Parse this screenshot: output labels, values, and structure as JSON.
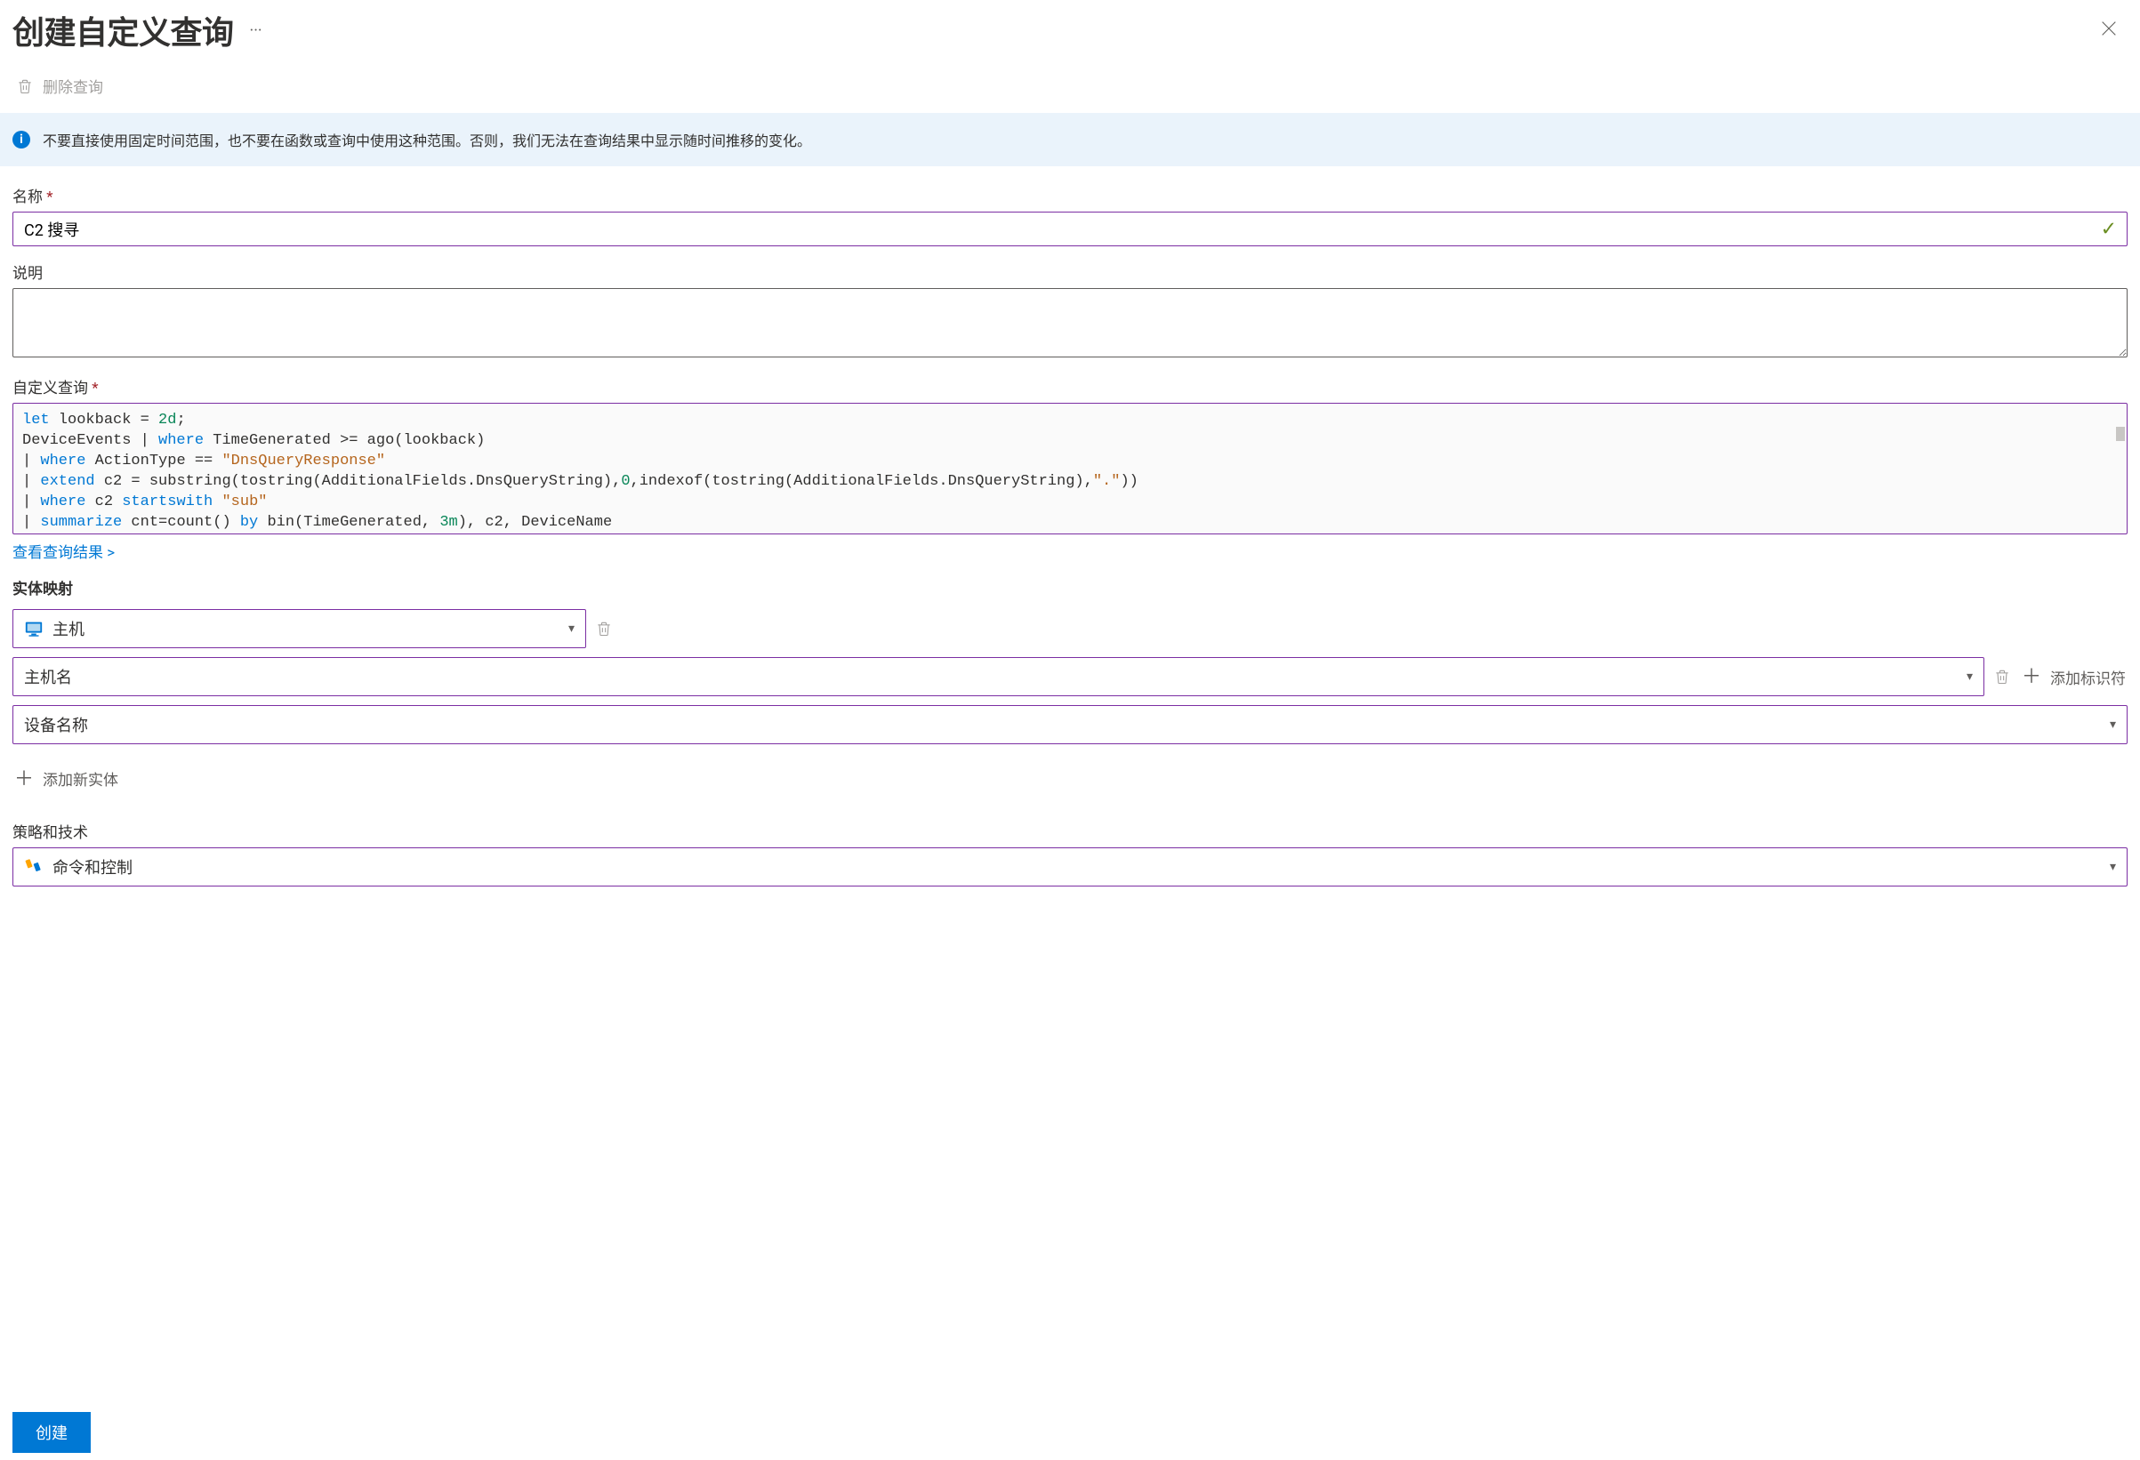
{
  "header": {
    "title": "创建自定义查询"
  },
  "toolbar": {
    "delete_query_label": "删除查询"
  },
  "info_bar": {
    "text": "不要直接使用固定时间范围，也不要在函数或查询中使用这种范围。否则，我们无法在查询结果中显示随时间推移的变化。"
  },
  "fields": {
    "name_label": "名称",
    "name_value": "C2 搜寻",
    "description_label": "说明",
    "description_value": "",
    "custom_query_label": "自定义查询",
    "view_results_link": "查看查询结果  >",
    "entity_mapping_heading": "实体映射",
    "entity_type_value": "主机",
    "identifier_value": "主机名",
    "column_value": "设备名称",
    "add_identifier_label": "添加标识符",
    "add_entity_label": "添加新实体",
    "tactics_heading": "策略和技术",
    "tactics_value": "命令和控制"
  },
  "query": {
    "tokens": [
      {
        "t": "k",
        "v": "let"
      },
      {
        "t": "p",
        "v": " lookback = "
      },
      {
        "t": "n",
        "v": "2d"
      },
      {
        "t": "p",
        "v": ";\n"
      },
      {
        "t": "p",
        "v": "DeviceEvents | "
      },
      {
        "t": "k",
        "v": "where"
      },
      {
        "t": "p",
        "v": " TimeGenerated >= ago(lookback)\n"
      },
      {
        "t": "p",
        "v": "| "
      },
      {
        "t": "k",
        "v": "where"
      },
      {
        "t": "p",
        "v": " ActionType == "
      },
      {
        "t": "s",
        "v": "\"DnsQueryResponse\""
      },
      {
        "t": "p",
        "v": "\n"
      },
      {
        "t": "p",
        "v": "| "
      },
      {
        "t": "k",
        "v": "extend"
      },
      {
        "t": "p",
        "v": " c2 = substring(tostring(AdditionalFields.DnsQueryString),"
      },
      {
        "t": "n",
        "v": "0"
      },
      {
        "t": "p",
        "v": ",indexof(tostring(AdditionalFields.DnsQueryString),"
      },
      {
        "t": "s",
        "v": "\".\""
      },
      {
        "t": "p",
        "v": "))\n"
      },
      {
        "t": "p",
        "v": "| "
      },
      {
        "t": "k",
        "v": "where"
      },
      {
        "t": "p",
        "v": " c2 "
      },
      {
        "t": "k",
        "v": "startswith"
      },
      {
        "t": "p",
        "v": " "
      },
      {
        "t": "s",
        "v": "\"sub\""
      },
      {
        "t": "p",
        "v": "\n"
      },
      {
        "t": "p",
        "v": "| "
      },
      {
        "t": "k",
        "v": "summarize"
      },
      {
        "t": "p",
        "v": " cnt=count() "
      },
      {
        "t": "k",
        "v": "by"
      },
      {
        "t": "p",
        "v": " bin(TimeGenerated, "
      },
      {
        "t": "n",
        "v": "3m"
      },
      {
        "t": "p",
        "v": "), c2, DeviceName\n"
      }
    ]
  },
  "footer": {
    "create_label": "创建"
  },
  "colors": {
    "accent_purple": "#7b2ea3",
    "primary_blue": "#0078d4",
    "info_bg": "#eaf3fb"
  }
}
